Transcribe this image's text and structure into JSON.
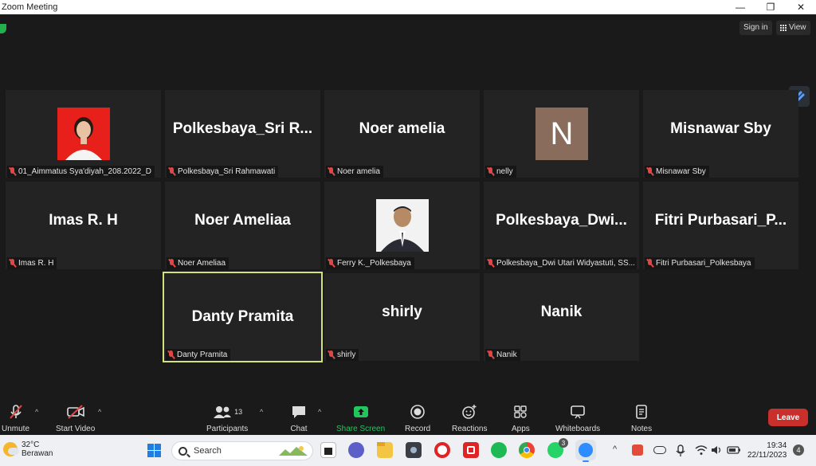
{
  "window": {
    "title": "Zoom Meeting",
    "minimize_glyph": "—",
    "maximize_glyph": "❐",
    "close_glyph": "✕"
  },
  "topbar": {
    "signin_label": "Sign in",
    "view_label": "View"
  },
  "participants_grid": [
    {
      "display": "",
      "tag": "01_Aimmatus Sya'diyah_208.2022_D",
      "avatar": "photo-woman"
    },
    {
      "display": "Polkesbaya_Sri  R...",
      "tag": "Polkesbaya_Sri Rahmawati",
      "avatar": "none"
    },
    {
      "display": "Noer amelia",
      "tag": "Noer amelia",
      "avatar": "none"
    },
    {
      "display": "N",
      "tag": "nelly",
      "avatar": "letter"
    },
    {
      "display": "Misnawar Sby",
      "tag": "Misnawar Sby",
      "avatar": "none"
    },
    {
      "display": "Imas R. H",
      "tag": "Imas R. H",
      "avatar": "none"
    },
    {
      "display": "Noer Ameliaa",
      "tag": "Noer Ameliaa",
      "avatar": "none"
    },
    {
      "display": "",
      "tag": "Ferry K._Polkesbaya",
      "avatar": "photo-man"
    },
    {
      "display": "Polkesbaya_Dwi...",
      "tag": "Polkesbaya_Dwi Utari Widyastuti, SS...",
      "avatar": "none"
    },
    {
      "display": "Fitri  Purbasari_P...",
      "tag": "Fitri Purbasari_Polkesbaya",
      "avatar": "none"
    },
    {
      "display": "Danty Pramita",
      "tag": "Danty Pramita",
      "avatar": "none",
      "active_speaker": true
    },
    {
      "display": "shirly",
      "tag": "shirly",
      "avatar": "none"
    },
    {
      "display": "Nanik",
      "tag": "Nanik",
      "avatar": "none"
    }
  ],
  "toolbar": {
    "unmute_label": "Unmute",
    "start_video_label": "Start Video",
    "participants_label": "Participants",
    "participants_count": "13",
    "chat_label": "Chat",
    "share_screen_label": "Share Screen",
    "record_label": "Record",
    "reactions_label": "Reactions",
    "apps_label": "Apps",
    "whiteboards_label": "Whiteboards",
    "notes_label": "Notes",
    "leave_label": "Leave",
    "caret_glyph": "^"
  },
  "taskbar": {
    "weather_temp": "32°C",
    "weather_desc": "Berawan",
    "search_label": "Search",
    "whatsapp_badge": "3",
    "time": "19:34",
    "date": "22/11/2023",
    "notification_count": "4",
    "tray_chevron": "^"
  },
  "colors": {
    "accent_green": "#22c55e",
    "leave_red": "#c9302c",
    "active_speaker_border": "#d4e17c",
    "muted_red": "#e04646"
  }
}
